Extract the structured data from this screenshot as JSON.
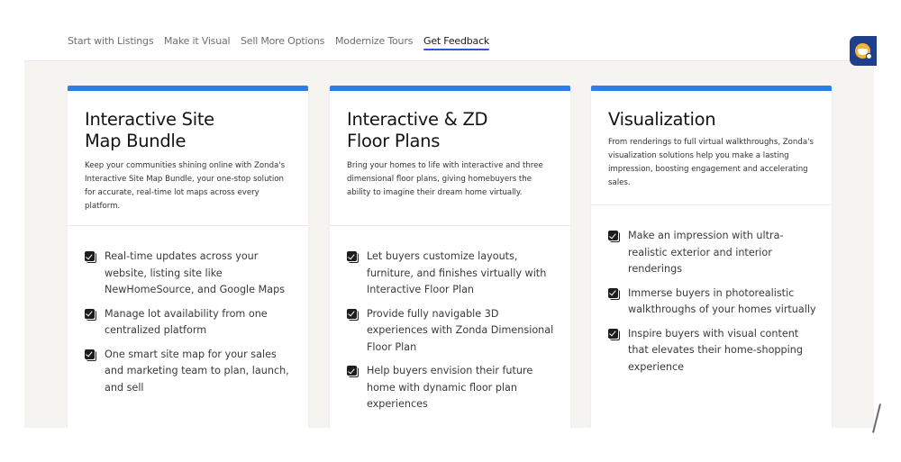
{
  "tabs": [
    {
      "label": "Start with Listings",
      "active": false
    },
    {
      "label": "Make it Visual",
      "active": false
    },
    {
      "label": "Sell More Options",
      "active": false
    },
    {
      "label": "Modernize Tours",
      "active": false
    },
    {
      "label": "Get Feedback",
      "active": true
    }
  ],
  "colors": {
    "accent_bar": "#2f7de6",
    "active_tab_underline": "#2f56d6",
    "chat_button": "#1f3f8a"
  },
  "cards": [
    {
      "title_lines": [
        "Interactive Site",
        "Map Bundle"
      ],
      "description": "Keep your communities shining online with Zonda's Interactive Site Map Bundle, your one-stop solution for accurate, real-time lot maps across every platform.",
      "items": [
        "Real-time updates across your website, listing site like NewHomeSource, and Google Maps",
        "Manage lot availability from one centralized platform",
        "One smart site map for your sales and marketing team to plan, launch, and sell"
      ]
    },
    {
      "title_lines": [
        "Interactive & ZD",
        "Floor Plans"
      ],
      "description": "Bring your homes to life with interactive and three dimensional floor plans, giving homebuyers the ability to imagine their dream home virtually.",
      "items": [
        "Let buyers customize layouts, furniture, and finishes virtually with Interactive Floor Plan",
        "Provide fully navigable 3D experiences with Zonda Dimensional Floor Plan",
        "Help buyers envision their future home with dynamic floor plan experiences"
      ]
    },
    {
      "title_lines": [
        "Visualization"
      ],
      "description": "From renderings to full virtual walkthroughs, Zonda's visualization solutions help you make a lasting impression, boosting engagement and accelerating sales.",
      "items": [
        "Make an impression with ultra-realistic exterior and interior renderings",
        "Immerse buyers in photorealistic walkthroughs of your homes virtually",
        "Inspire buyers with visual content that elevates their home-shopping experience"
      ]
    }
  ],
  "chat_widget": {
    "icon": "chat-assistant-icon"
  }
}
